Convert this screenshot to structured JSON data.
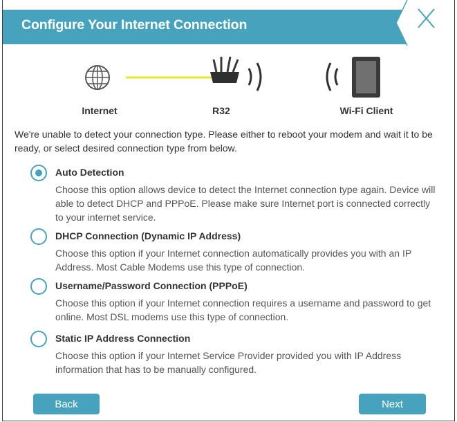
{
  "dialog": {
    "title": "Configure Your Internet Connection"
  },
  "diagram": {
    "nodes": [
      {
        "label": "Internet",
        "icon": "globe-icon"
      },
      {
        "label": "R32",
        "icon": "router-icon"
      },
      {
        "label": "Wi-Fi Client",
        "icon": "tablet-icon"
      }
    ],
    "link_color": "#e5e533"
  },
  "intro_text": "We're unable to detect your connection type. Please either to reboot your modem and wait it to be ready, or select desired connection type from below.",
  "options": [
    {
      "title": "Auto Detection",
      "description": "Choose this option allows device to detect the Internet connection type again. Device will able to detect DHCP and PPPoE. Please make sure Internet port is connected correctly to your internet service.",
      "selected": true
    },
    {
      "title": "DHCP Connection (Dynamic IP Address)",
      "description": "Choose this option if your Internet connection automatically provides you with an IP Address. Most Cable Modems use this type of connection.",
      "selected": false
    },
    {
      "title": "Username/Password Connection (PPPoE)",
      "description": "Choose this option if your Internet connection requires a username and password to get online. Most DSL modems use this type of connection.",
      "selected": false
    },
    {
      "title": "Static IP Address Connection",
      "description": "Choose this option if your Internet Service Provider provided you with IP Address information that has to be manually configured.",
      "selected": false
    }
  ],
  "buttons": {
    "back": "Back",
    "next": "Next"
  },
  "colors": {
    "accent": "#47a3bd",
    "text": "#333333"
  }
}
